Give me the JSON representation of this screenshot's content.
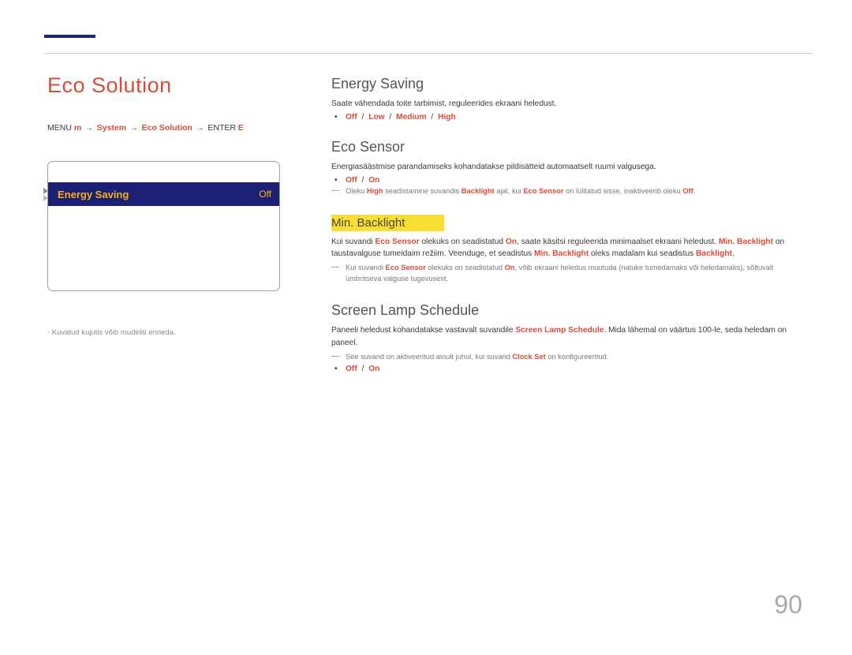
{
  "leftPanel": {
    "title": "Eco Solution",
    "breadcrumb": {
      "pre": "MENU ",
      "menu": "m",
      "arrow1": " → ",
      "sys": "System",
      "arrow2": " → ",
      "eco": "Eco Solution",
      "arrow3": " → ",
      "enter": "ENTER ",
      "enterIcon": "E"
    },
    "panelLabel": "Energy Saving",
    "panelValue": "Off",
    "footnote": "- Kuvatud kujutis võib mudeliti erineda."
  },
  "sections": {
    "energySaving": {
      "title": "Energy Saving",
      "desc": "Saate vähendada toite tarbimist, reguleerides ekraani heledust.",
      "bullet": {
        "off": "Off",
        "sep": " / ",
        "low": "Low",
        "sep2": " / ",
        "med": "Medium",
        "sep3": " / ",
        "high": "High"
      }
    },
    "ecoSensor": {
      "title": "Eco Sensor",
      "desc": "Energiasäästmise parandamiseks kohandatakse pildisätteid automaatselt ruumi valgusega.",
      "bullet": {
        "off": "Off",
        "sep": " / ",
        "on": "On"
      },
      "note": {
        "p1": "Oleku ",
        "h1": "High",
        "p2": " seadistamine suvandis ",
        "h2": "Backlight",
        "p3": " ajal, kui ",
        "h3": "Eco Sensor",
        "p4": " on lülitatud sisse, inaktiveerib oleku ",
        "h4": "Off",
        "p5": "."
      }
    },
    "minBacklight": {
      "title": "Min. Backlight",
      "desc": {
        "p1": "Kui suvandi ",
        "h1": "Eco Sensor",
        "p2": " olekuks on seadistatud ",
        "h2": "On",
        "p3": ", saate käsitsi reguleerida minimaalset ekraani heledust. ",
        "h3": "Min. Backlight",
        "p4": " on taustavalguse tumeidaim režiim. Veenduge, et seadistus ",
        "h4": "Min. Backlight",
        "p5": " oleks madalam kui seadistus ",
        "h5": "Backlight",
        "p6": "."
      },
      "note": {
        "p1": "Kui suvandi ",
        "h1": "Eco Sensor",
        "p2": " olekuks on seadistatud ",
        "h2": "On",
        "p3": ", võib ekraani heledus muutuda (natuke tumedamaks või heledamaks), sõltuvalt ümbritseva valguse tugevusest."
      }
    },
    "screenLamp": {
      "title": "Screen Lamp Schedule",
      "desc": {
        "p1": "Paneeli heledust kohandatakse vastavalt suvandile ",
        "h1": "Screen Lamp Schedule",
        "p2": ". Mida lähemal on väärtus 100-le, seda heledam on paneel."
      },
      "note": {
        "p1": "See suvand on aktiveeritud ainult juhul, kui suvand ",
        "h1": "Clock Set",
        "p2": " on konfigureeritud."
      },
      "bullet": {
        "off": "Off",
        "sep": " / ",
        "on": "On"
      }
    }
  },
  "pageNum": "90"
}
